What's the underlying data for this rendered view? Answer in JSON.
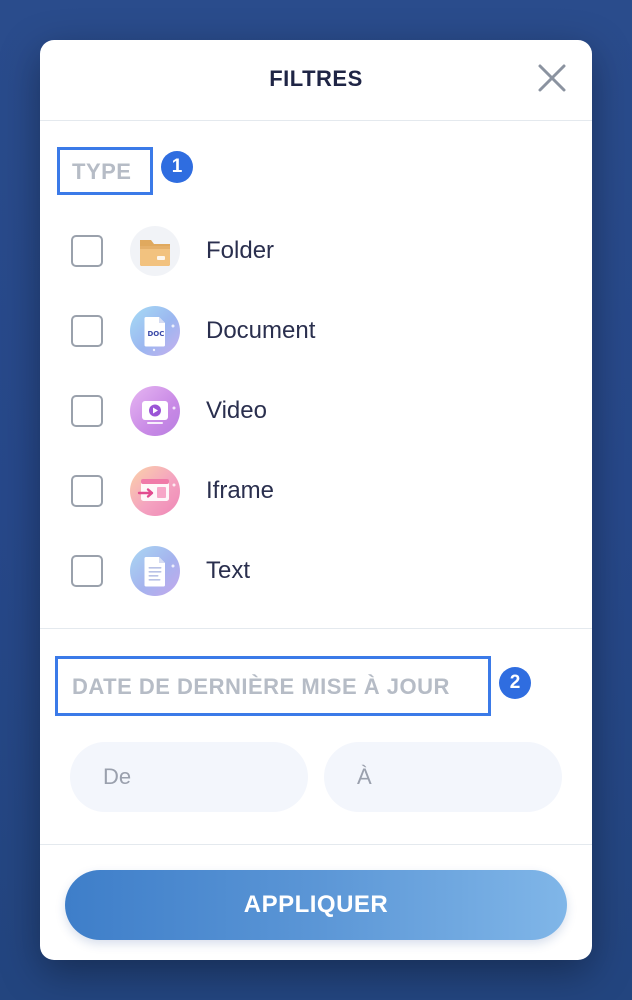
{
  "modal": {
    "title": "FILTRES",
    "close_icon": "close-icon"
  },
  "type_section": {
    "label": "TYPE",
    "annotation_number": "1",
    "items": [
      {
        "label": "Folder",
        "icon": "folder-icon",
        "checked": false
      },
      {
        "label": "Document",
        "icon": "document-icon",
        "checked": false
      },
      {
        "label": "Video",
        "icon": "video-icon",
        "checked": false
      },
      {
        "label": "Iframe",
        "icon": "iframe-icon",
        "checked": false
      },
      {
        "label": "Text",
        "icon": "text-icon",
        "checked": false
      }
    ]
  },
  "date_section": {
    "label": "DATE DE DERNIÈRE MISE À JOUR",
    "annotation_number": "2",
    "from_placeholder": "De",
    "to_placeholder": "À"
  },
  "apply_label": "APPLIQUER",
  "colors": {
    "background": "#27488a",
    "annotation_blue": "#3b7ae8",
    "badge_blue": "#2f6de0",
    "button_gradient_start": "#3e7ec9",
    "button_gradient_end": "#80b6e8",
    "label_gray": "#b6bcc6"
  }
}
